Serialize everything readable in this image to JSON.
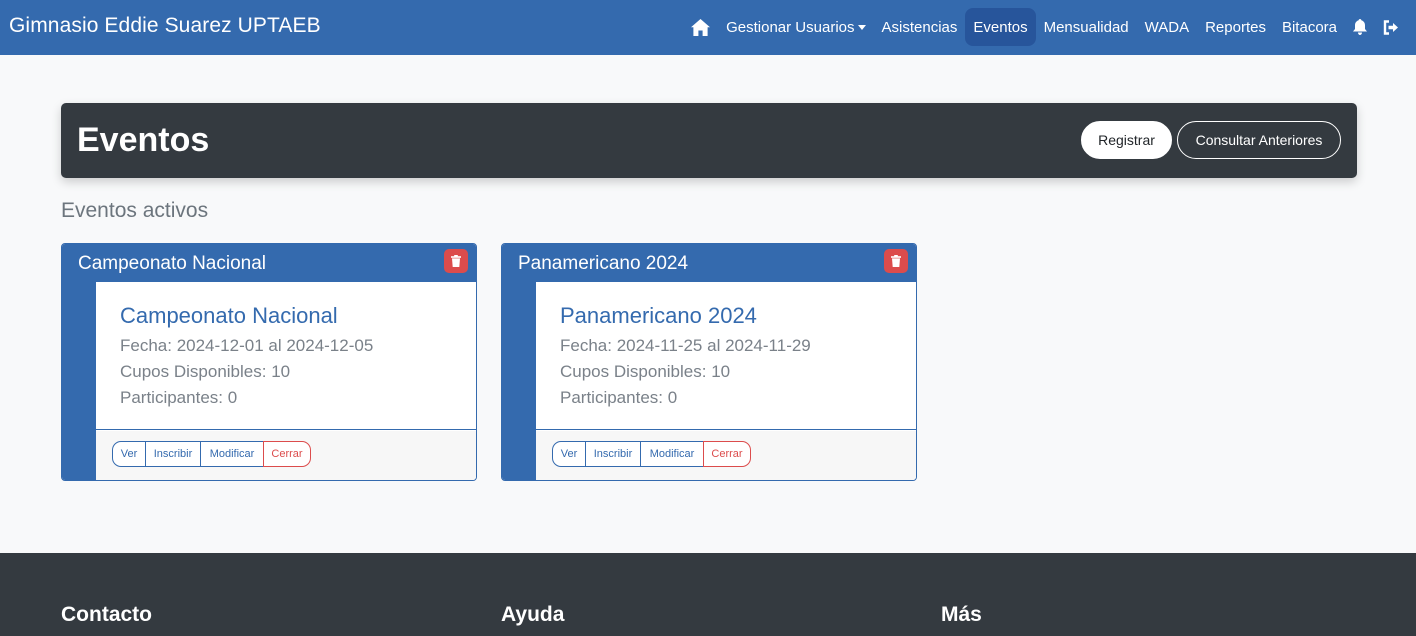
{
  "navbar": {
    "brand": "Gimnasio Eddie Suarez UPTAEB",
    "items": [
      {
        "label": "Gestionar Usuarios",
        "dropdown": true
      },
      {
        "label": "Asistencias"
      },
      {
        "label": "Eventos",
        "active": true
      },
      {
        "label": "Mensualidad"
      },
      {
        "label": "WADA"
      },
      {
        "label": "Reportes"
      },
      {
        "label": "Bitacora"
      }
    ],
    "icons": [
      "home-icon",
      "bell-icon",
      "logout-icon"
    ]
  },
  "header": {
    "title": "Eventos",
    "register_label": "Registrar",
    "previous_label": "Consultar Anteriores"
  },
  "section_title": "Eventos activos",
  "events": [
    {
      "header": "Campeonato Nacional",
      "name": "Campeonato Nacional",
      "fecha": "Fecha: 2024-12-01 al 2024-12-05",
      "cupos": "Cupos Disponibles: 10",
      "participantes": "Participantes: 0",
      "actions": {
        "ver": "Ver",
        "inscribir": "Inscribir",
        "modificar": "Modificar",
        "cerrar": "Cerrar"
      }
    },
    {
      "header": "Panamericano 2024",
      "name": "Panamericano 2024",
      "fecha": "Fecha: 2024-11-25 al 2024-11-29",
      "cupos": "Cupos Disponibles: 10",
      "participantes": "Participantes: 0",
      "actions": {
        "ver": "Ver",
        "inscribir": "Inscribir",
        "modificar": "Modificar",
        "cerrar": "Cerrar"
      }
    }
  ],
  "footer": {
    "headings": [
      "Contacto",
      "Ayuda",
      "Más"
    ]
  },
  "colors": {
    "primary": "#346aae",
    "dark": "#343a40",
    "danger": "#dc4c4c"
  }
}
